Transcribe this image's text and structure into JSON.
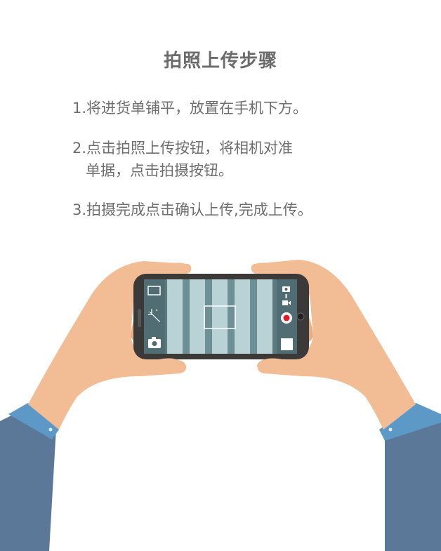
{
  "title": "拍照上传步骤",
  "steps": [
    {
      "line1": "1.将进货单铺平，放置在手机下方。"
    },
    {
      "line1": "2.点击拍照上传按钮，将相机对准",
      "line2": "单据，点击拍摄按钮。"
    },
    {
      "line1": "3.拍摄完成点击确认上传,完成上传。"
    }
  ],
  "colors": {
    "skin": "#f2bc94",
    "sleeve": "#5b7898",
    "cuff": "#5d99c6",
    "phone": "#3c3a39",
    "screen_stripe_light": "#b8d2d6",
    "screen_stripe_dark": "#6e8f94",
    "record": "#e31b2a"
  },
  "icons": [
    "square-frame-icon",
    "magic-wand-icon",
    "camera-icon",
    "photo-mode-icon",
    "video-mode-icon",
    "record-button-icon",
    "gallery-thumbnail-icon"
  ]
}
